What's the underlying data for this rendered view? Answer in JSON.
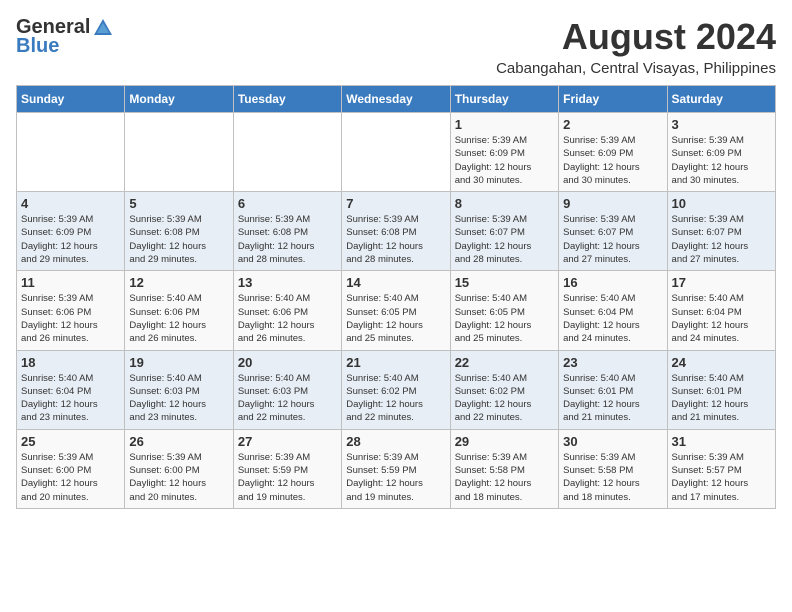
{
  "logo": {
    "general": "General",
    "blue": "Blue"
  },
  "title": "August 2024",
  "subtitle": "Cabangahan, Central Visayas, Philippines",
  "days_of_week": [
    "Sunday",
    "Monday",
    "Tuesday",
    "Wednesday",
    "Thursday",
    "Friday",
    "Saturday"
  ],
  "weeks": [
    [
      {
        "day": "",
        "info": ""
      },
      {
        "day": "",
        "info": ""
      },
      {
        "day": "",
        "info": ""
      },
      {
        "day": "",
        "info": ""
      },
      {
        "day": "1",
        "info": "Sunrise: 5:39 AM\nSunset: 6:09 PM\nDaylight: 12 hours\nand 30 minutes."
      },
      {
        "day": "2",
        "info": "Sunrise: 5:39 AM\nSunset: 6:09 PM\nDaylight: 12 hours\nand 30 minutes."
      },
      {
        "day": "3",
        "info": "Sunrise: 5:39 AM\nSunset: 6:09 PM\nDaylight: 12 hours\nand 30 minutes."
      }
    ],
    [
      {
        "day": "4",
        "info": "Sunrise: 5:39 AM\nSunset: 6:09 PM\nDaylight: 12 hours\nand 29 minutes."
      },
      {
        "day": "5",
        "info": "Sunrise: 5:39 AM\nSunset: 6:08 PM\nDaylight: 12 hours\nand 29 minutes."
      },
      {
        "day": "6",
        "info": "Sunrise: 5:39 AM\nSunset: 6:08 PM\nDaylight: 12 hours\nand 28 minutes."
      },
      {
        "day": "7",
        "info": "Sunrise: 5:39 AM\nSunset: 6:08 PM\nDaylight: 12 hours\nand 28 minutes."
      },
      {
        "day": "8",
        "info": "Sunrise: 5:39 AM\nSunset: 6:07 PM\nDaylight: 12 hours\nand 28 minutes."
      },
      {
        "day": "9",
        "info": "Sunrise: 5:39 AM\nSunset: 6:07 PM\nDaylight: 12 hours\nand 27 minutes."
      },
      {
        "day": "10",
        "info": "Sunrise: 5:39 AM\nSunset: 6:07 PM\nDaylight: 12 hours\nand 27 minutes."
      }
    ],
    [
      {
        "day": "11",
        "info": "Sunrise: 5:39 AM\nSunset: 6:06 PM\nDaylight: 12 hours\nand 26 minutes."
      },
      {
        "day": "12",
        "info": "Sunrise: 5:40 AM\nSunset: 6:06 PM\nDaylight: 12 hours\nand 26 minutes."
      },
      {
        "day": "13",
        "info": "Sunrise: 5:40 AM\nSunset: 6:06 PM\nDaylight: 12 hours\nand 26 minutes."
      },
      {
        "day": "14",
        "info": "Sunrise: 5:40 AM\nSunset: 6:05 PM\nDaylight: 12 hours\nand 25 minutes."
      },
      {
        "day": "15",
        "info": "Sunrise: 5:40 AM\nSunset: 6:05 PM\nDaylight: 12 hours\nand 25 minutes."
      },
      {
        "day": "16",
        "info": "Sunrise: 5:40 AM\nSunset: 6:04 PM\nDaylight: 12 hours\nand 24 minutes."
      },
      {
        "day": "17",
        "info": "Sunrise: 5:40 AM\nSunset: 6:04 PM\nDaylight: 12 hours\nand 24 minutes."
      }
    ],
    [
      {
        "day": "18",
        "info": "Sunrise: 5:40 AM\nSunset: 6:04 PM\nDaylight: 12 hours\nand 23 minutes."
      },
      {
        "day": "19",
        "info": "Sunrise: 5:40 AM\nSunset: 6:03 PM\nDaylight: 12 hours\nand 23 minutes."
      },
      {
        "day": "20",
        "info": "Sunrise: 5:40 AM\nSunset: 6:03 PM\nDaylight: 12 hours\nand 22 minutes."
      },
      {
        "day": "21",
        "info": "Sunrise: 5:40 AM\nSunset: 6:02 PM\nDaylight: 12 hours\nand 22 minutes."
      },
      {
        "day": "22",
        "info": "Sunrise: 5:40 AM\nSunset: 6:02 PM\nDaylight: 12 hours\nand 22 minutes."
      },
      {
        "day": "23",
        "info": "Sunrise: 5:40 AM\nSunset: 6:01 PM\nDaylight: 12 hours\nand 21 minutes."
      },
      {
        "day": "24",
        "info": "Sunrise: 5:40 AM\nSunset: 6:01 PM\nDaylight: 12 hours\nand 21 minutes."
      }
    ],
    [
      {
        "day": "25",
        "info": "Sunrise: 5:39 AM\nSunset: 6:00 PM\nDaylight: 12 hours\nand 20 minutes."
      },
      {
        "day": "26",
        "info": "Sunrise: 5:39 AM\nSunset: 6:00 PM\nDaylight: 12 hours\nand 20 minutes."
      },
      {
        "day": "27",
        "info": "Sunrise: 5:39 AM\nSunset: 5:59 PM\nDaylight: 12 hours\nand 19 minutes."
      },
      {
        "day": "28",
        "info": "Sunrise: 5:39 AM\nSunset: 5:59 PM\nDaylight: 12 hours\nand 19 minutes."
      },
      {
        "day": "29",
        "info": "Sunrise: 5:39 AM\nSunset: 5:58 PM\nDaylight: 12 hours\nand 18 minutes."
      },
      {
        "day": "30",
        "info": "Sunrise: 5:39 AM\nSunset: 5:58 PM\nDaylight: 12 hours\nand 18 minutes."
      },
      {
        "day": "31",
        "info": "Sunrise: 5:39 AM\nSunset: 5:57 PM\nDaylight: 12 hours\nand 17 minutes."
      }
    ]
  ]
}
